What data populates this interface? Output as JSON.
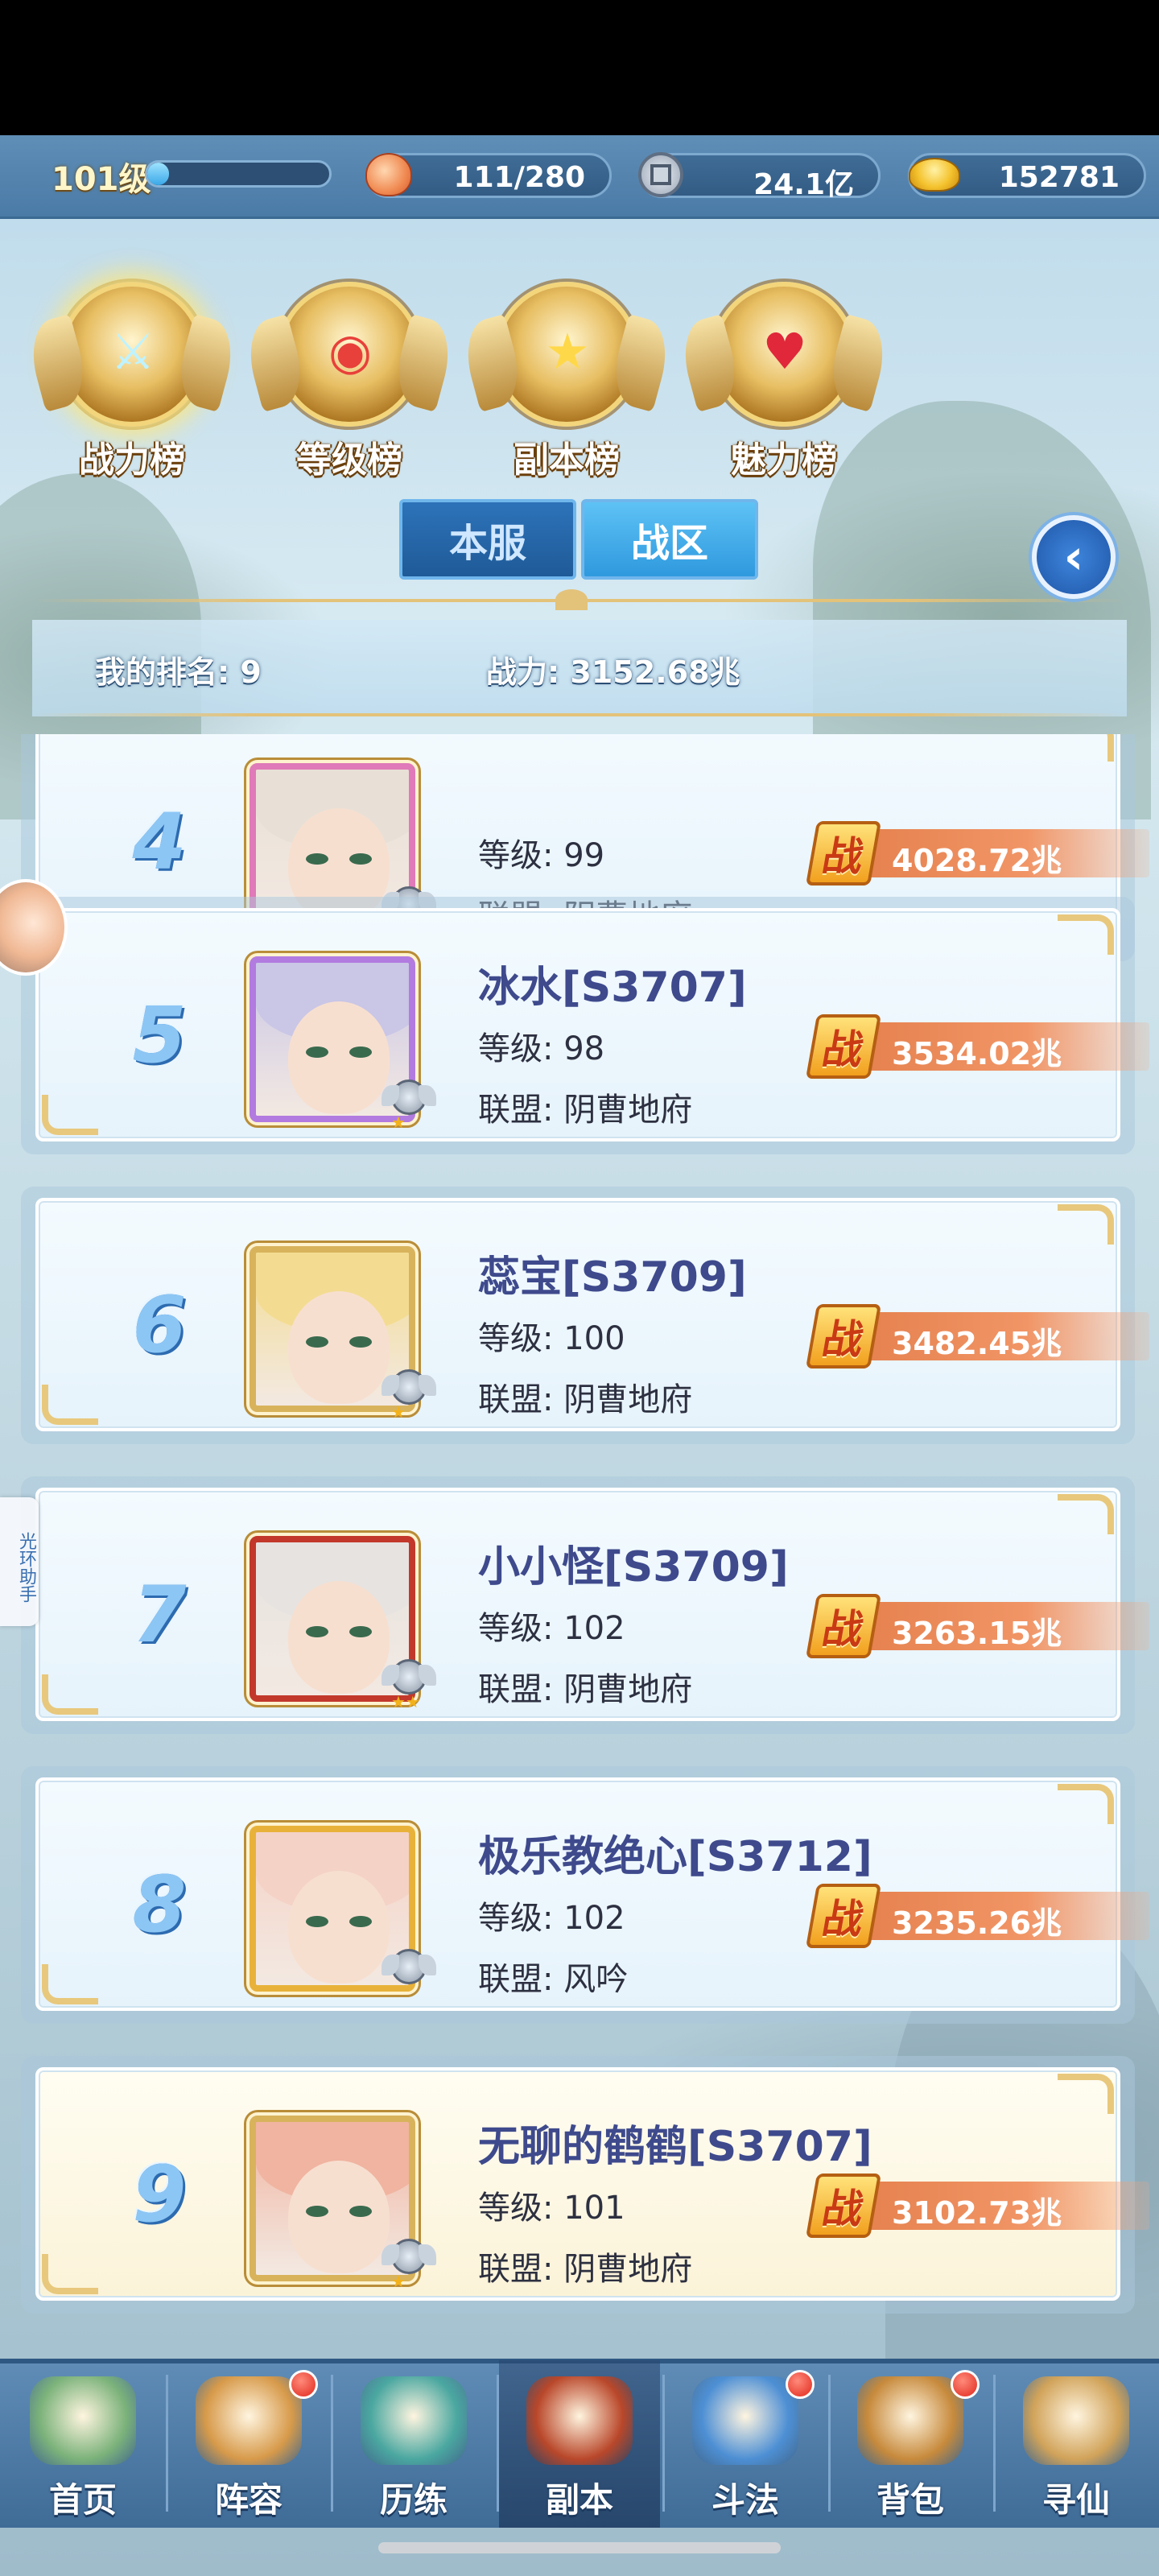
{
  "resources": {
    "level": "101级",
    "xp_fraction": 0.12,
    "stamina": "111/280",
    "silver": "24.1亿",
    "gold": "152781"
  },
  "category_tabs": [
    {
      "label": "战力榜",
      "icon": "sword-emblem-icon",
      "active": true
    },
    {
      "label": "等级榜",
      "icon": "drum-emblem-icon",
      "active": false
    },
    {
      "label": "副本榜",
      "icon": "star-emblem-icon",
      "active": false
    },
    {
      "label": "魅力榜",
      "icon": "heart-emblem-icon",
      "active": false
    }
  ],
  "server_toggle": {
    "local": "本服",
    "zone": "战区",
    "selected": "zone"
  },
  "my_rank": {
    "rank_label": "我的排名: 9",
    "power_label": "战力: 3152.68兆"
  },
  "rows": [
    {
      "rank": "4",
      "name": "",
      "level": "等级: 99",
      "alliance": "联盟: 阴曹地府",
      "power": "4028.72兆",
      "stars": "★",
      "hair": "#e8e0d6",
      "frame": "#e07ab8"
    },
    {
      "rank": "5",
      "name": "冰水[S3707]",
      "level": "等级: 98",
      "alliance": "联盟: 阴曹地府",
      "power": "3534.02兆",
      "stars": "★",
      "hair": "#c9c6e6",
      "frame": "#b27be0"
    },
    {
      "rank": "6",
      "name": "蕊宝[S3709]",
      "level": "等级: 100",
      "alliance": "联盟: 阴曹地府",
      "power": "3482.45兆",
      "stars": "★",
      "hair": "#f3dc92",
      "frame": "#d8b35c"
    },
    {
      "rank": "7",
      "name": "小小怪[S3709]",
      "level": "等级: 102",
      "alliance": "联盟: 阴曹地府",
      "power": "3263.15兆",
      "stars": "★★",
      "hair": "#e6e3e0",
      "frame": "#c2382b"
    },
    {
      "rank": "8",
      "name": "极乐教绝心[S3712]",
      "level": "等级: 102",
      "alliance": "联盟: 风吟",
      "power": "3235.26兆",
      "stars": "",
      "hair": "#f4d2c6",
      "frame": "#e8b23a"
    },
    {
      "rank": "9",
      "name": "无聊的鹤鹤[S3707]",
      "level": "等级: 101",
      "alliance": "联盟: 阴曹地府",
      "power": "3102.73兆",
      "stars": "★",
      "hair": "#f0b4a0",
      "frame": "#d8b35c",
      "is_me": true
    }
  ],
  "power_glyph": "战",
  "side_tab": "光环助手",
  "bottom_nav": [
    {
      "label": "首页",
      "icon": "home-island-icon",
      "badge": false,
      "color": "#7bb27a"
    },
    {
      "label": "阵容",
      "icon": "cards-lineup-icon",
      "badge": true,
      "color": "#d79a4a"
    },
    {
      "label": "历练",
      "icon": "training-creature-icon",
      "badge": false,
      "color": "#4aa7a0"
    },
    {
      "label": "副本",
      "icon": "dungeon-gate-icon",
      "badge": false,
      "color": "#b9472a",
      "active": true
    },
    {
      "label": "斗法",
      "icon": "battle-sword-icon",
      "badge": true,
      "color": "#4d8fd4"
    },
    {
      "label": "背包",
      "icon": "backpack-icon",
      "badge": true,
      "color": "#c78a3c"
    },
    {
      "label": "寻仙",
      "icon": "scroll-map-icon",
      "badge": false,
      "color": "#d1a35a"
    }
  ]
}
